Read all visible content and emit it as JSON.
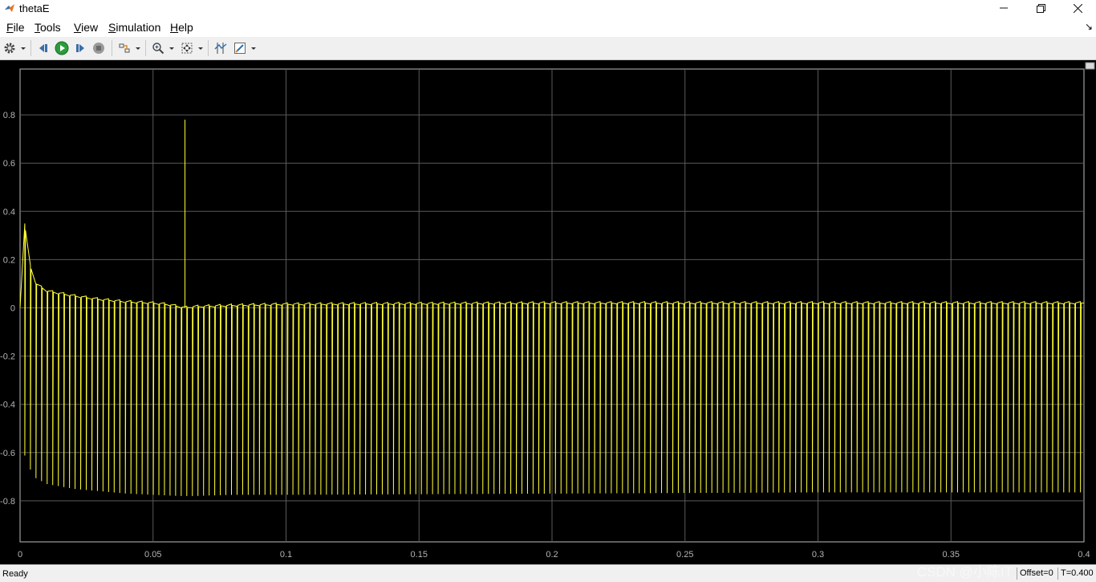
{
  "window": {
    "title": "thetaE",
    "minimize_icon": "minimize-icon",
    "maximize_icon": "restore-icon",
    "close_icon": "close-icon"
  },
  "menu": {
    "items": [
      {
        "label": "File",
        "underline": "F",
        "rest": "ile"
      },
      {
        "label": "Tools",
        "underline": "T",
        "rest": "ools"
      },
      {
        "label": "View",
        "underline": "V",
        "rest": "iew"
      },
      {
        "label": "Simulation",
        "underline": "S",
        "rest": "imulation"
      },
      {
        "label": "Help",
        "underline": "H",
        "rest": "elp"
      }
    ]
  },
  "toolbar": {
    "buttons": [
      "settings-icon",
      "step-back-icon",
      "run-icon",
      "step-forward-icon",
      "stop-icon",
      "highlight-icon",
      "zoom-icon",
      "autoscale-icon",
      "cursor-measure-icon",
      "style-icon"
    ]
  },
  "status": {
    "text": "Ready",
    "offset": "Offset=0",
    "time": "T=0.400",
    "watermark": "CSDN @小陈IT"
  },
  "colors": {
    "signal": "#ffff33",
    "grid": "#5a5a5a",
    "axis_text": "#b4b4b4",
    "background": "#000000"
  },
  "chart_data": {
    "type": "line",
    "title": "",
    "xlabel": "",
    "ylabel": "",
    "xlim": [
      0,
      0.4
    ],
    "ylim": [
      -0.97,
      0.99
    ],
    "x_ticks": [
      0,
      0.05,
      0.1,
      0.15,
      0.2,
      0.25,
      0.3,
      0.35,
      0.4
    ],
    "x_tick_labels": [
      "0",
      "0.05",
      "0.1",
      "0.15",
      "0.2",
      "0.25",
      "0.3",
      "0.35",
      "0.4"
    ],
    "y_ticks": [
      -0.8,
      -0.6,
      -0.4,
      -0.2,
      0,
      0.2,
      0.4,
      0.6,
      0.8
    ],
    "y_tick_labels": [
      "-0.8",
      "-0.6",
      "-0.4",
      "-0.2",
      "0",
      "0.2",
      "0.4",
      "0.6",
      "0.8"
    ],
    "grid": true,
    "series": [
      {
        "color": "#ffff33",
        "upper_envelope": {
          "x": [
            0,
            0.0015,
            0.003,
            0.006,
            0.01,
            0.02,
            0.03,
            0.04,
            0.05,
            0.055,
            0.06,
            0.062,
            0.065,
            0.08,
            0.1,
            0.2,
            0.3,
            0.4
          ],
          "y": [
            0.0,
            0.39,
            0.2,
            0.1,
            0.07,
            0.05,
            0.035,
            0.025,
            0.02,
            0.015,
            0.005,
            0.0,
            0.005,
            0.01,
            0.015,
            0.02,
            0.02,
            0.02
          ]
        },
        "lower_envelope": {
          "x": [
            0,
            0.002,
            0.005,
            0.01,
            0.02,
            0.04,
            0.06,
            0.065,
            0.08,
            0.1,
            0.2,
            0.3,
            0.4
          ],
          "y": [
            -0.55,
            -0.62,
            -0.7,
            -0.73,
            -0.75,
            -0.77,
            -0.78,
            -0.78,
            -0.775,
            -0.775,
            -0.77,
            -0.765,
            -0.765
          ]
        },
        "spike": {
          "x": 0.062,
          "y": 0.78
        },
        "drop_period": 0.0021
      }
    ]
  }
}
